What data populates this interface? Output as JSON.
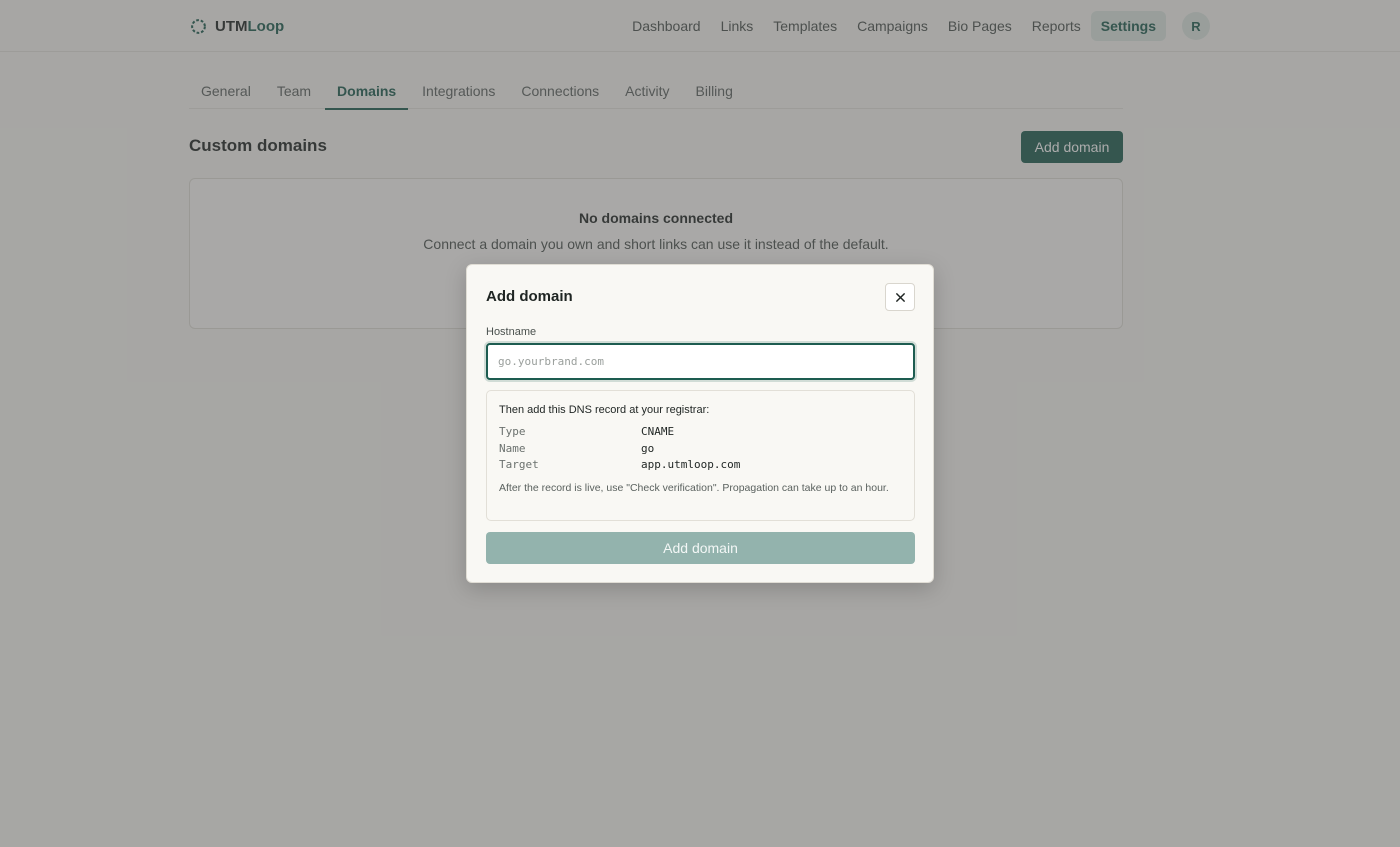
{
  "brand": {
    "name_part1": "UTM",
    "name_part2": "Loop",
    "accent": "#1d5c50"
  },
  "nav": {
    "items": [
      "Dashboard",
      "Links",
      "Templates",
      "Campaigns",
      "Bio Pages",
      "Reports",
      "Settings"
    ],
    "active": "Settings",
    "avatar_initial": "R"
  },
  "tabs": {
    "items": [
      "General",
      "Team",
      "Domains",
      "Integrations",
      "Connections",
      "Activity",
      "Billing"
    ],
    "active": "Domains"
  },
  "section": {
    "title": "Custom domains",
    "add_button": "Add domain"
  },
  "empty_state": {
    "title": "No domains connected",
    "description": "Connect a domain you own and short links can use it instead of the default."
  },
  "modal": {
    "title": "Add domain",
    "close_icon": "close-icon",
    "hostname_label": "Hostname",
    "hostname_value": "",
    "hostname_placeholder": "go.yourbrand.com",
    "dns_heading": "Then add this DNS record at your registrar:",
    "dns_records": [
      {
        "key": "Type",
        "value": "CNAME"
      },
      {
        "key": "Name",
        "value": "go"
      },
      {
        "key": "Target",
        "value": "app.utmloop.com"
      }
    ],
    "dns_note": "After the record is live, use \"Check verification\". Propagation can take up to an hour.",
    "submit_button": "Add domain"
  }
}
